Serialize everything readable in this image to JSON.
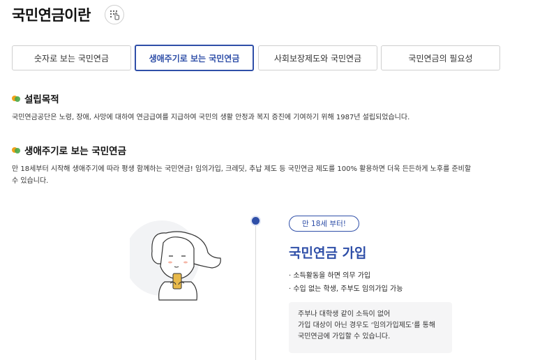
{
  "page": {
    "title": "국민연금이란"
  },
  "tabs": [
    {
      "label": "숫자로 보는 국민연금"
    },
    {
      "label": "생애주기로 보는 국민연금"
    },
    {
      "label": "사회보장제도와 국민연금"
    },
    {
      "label": "국민연금의 필요성"
    }
  ],
  "sections": {
    "founding": {
      "title": "설립목적",
      "text": "국민연금공단은 노령, 장애, 사망에 대하여 연금급여를 지급하여 국민의 생활 안정과 복지 증진에 기여하기 위해 1987년 설립되었습니다."
    },
    "lifecycle": {
      "title": "생애주기로 보는 국민연금",
      "text_line1": "만 18세부터 시작해 생애주기에 따라 평생 함께하는 국민연금! 임의가입, 크레딧, 추납 제도 등 국민연금 제도를 100% 활용하면 더욱 든든하게 노후를 준비할",
      "text_line2": "수 있습니다."
    }
  },
  "stage": {
    "age_badge": "만 18세 부터!",
    "title": "국민연금 가입",
    "bullets": [
      "소득활동을 하면 의무 가입",
      "수입 없는 학생, 주부도 임의가입 가능"
    ],
    "note": [
      "주부나 대학생 같이 소득이 없어",
      "가입 대상이 아닌 경우도 ‘임의가입제도’를 통해",
      "국민연금에 가입할 수 있습니다."
    ]
  },
  "colors": {
    "accent": "#2f4fa8",
    "bullet_orange": "#f0a21a",
    "bullet_green": "#4aa84a"
  },
  "icons": {
    "braille": "braille-icon",
    "timeline": "timeline-dot-icon"
  }
}
